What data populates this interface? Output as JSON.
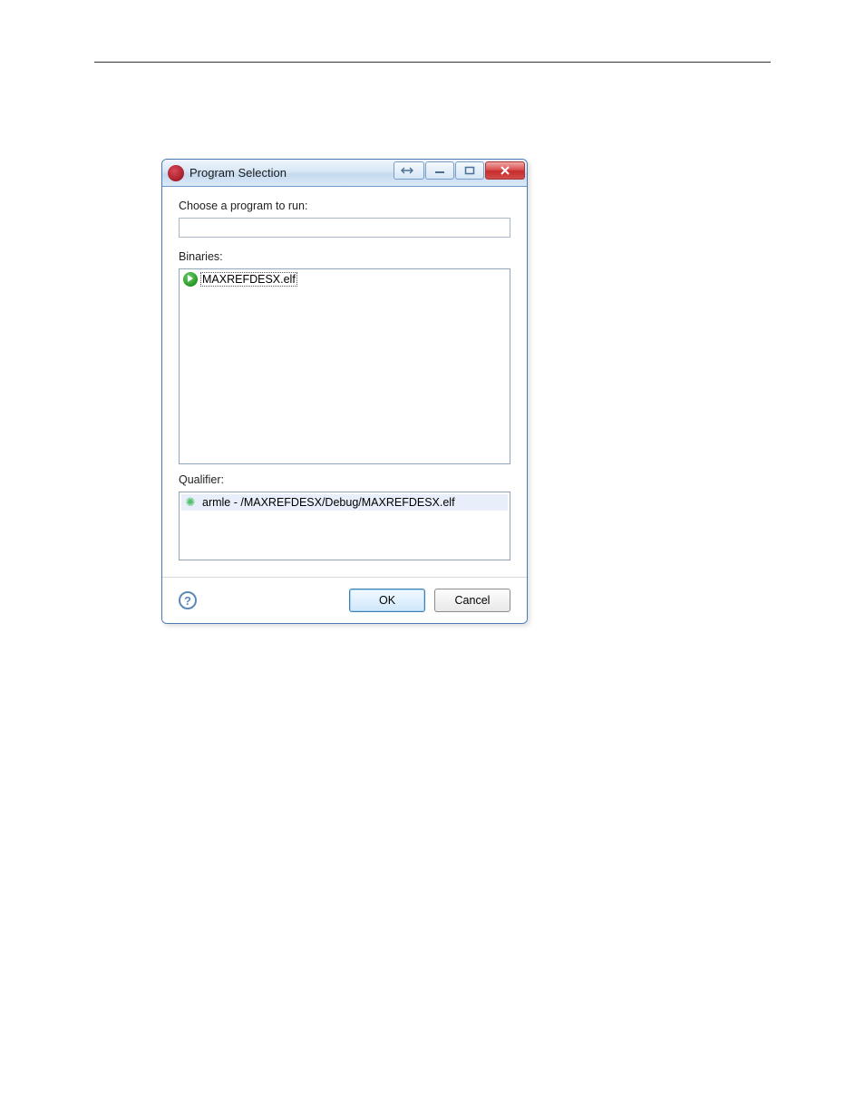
{
  "dialog": {
    "title": "Program Selection",
    "prompt_label": "Choose a program to run:",
    "filter_value": "",
    "binaries_label": "Binaries:",
    "binaries": [
      {
        "name": "MAXREFDESX.elf"
      }
    ],
    "qualifier_label": "Qualifier:",
    "qualifiers": [
      {
        "text": "armle - /MAXREFDESX/Debug/MAXREFDESX.elf"
      }
    ],
    "buttons": {
      "ok": "OK",
      "cancel": "Cancel"
    }
  }
}
